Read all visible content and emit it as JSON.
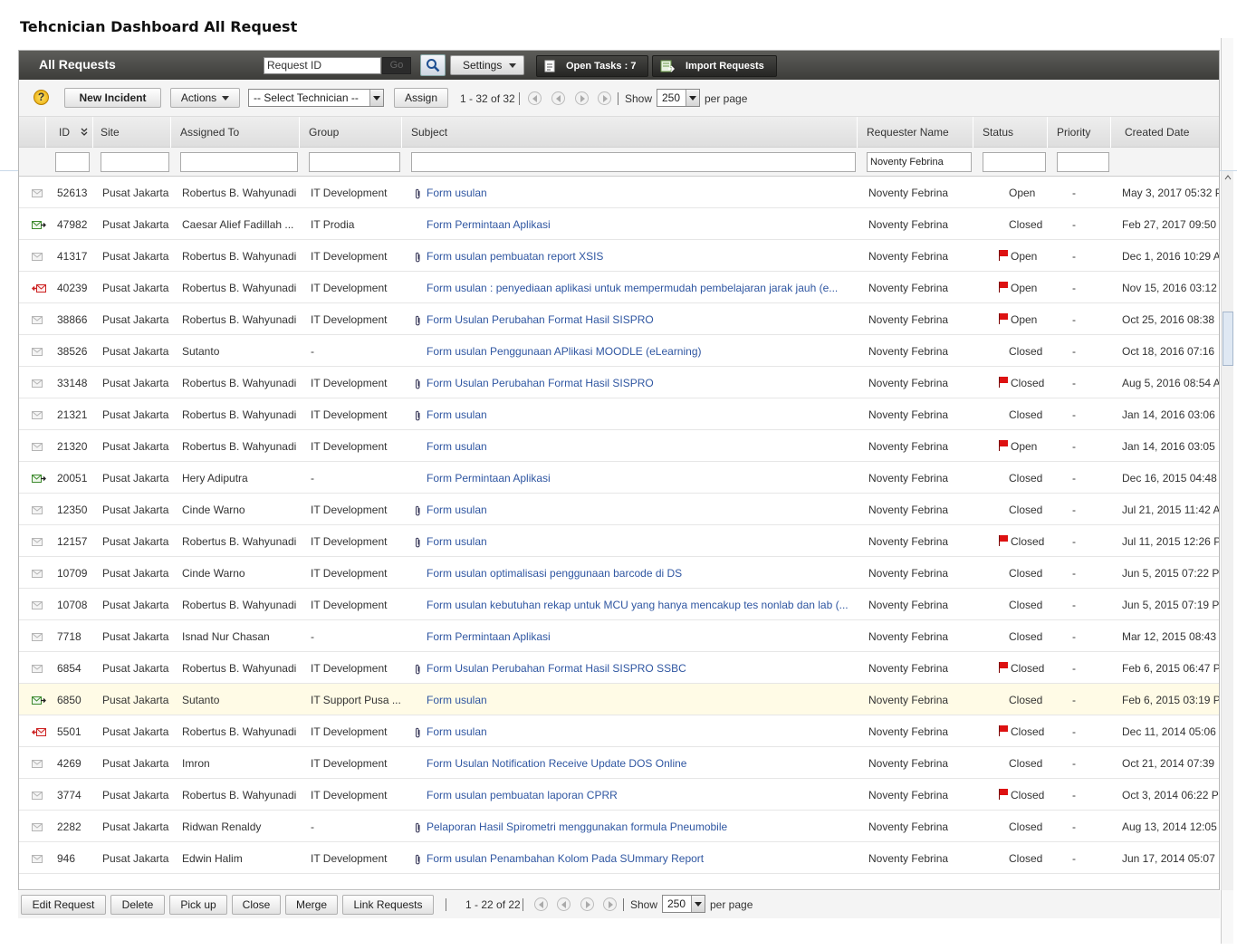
{
  "page_title": "Tehcnician Dashboard All Request",
  "header": {
    "title": "All Requests",
    "request_id_value": "Request ID",
    "go_label": "Go",
    "settings_label": "Settings",
    "open_tasks_label": "Open Tasks : 7",
    "import_label": "Import Requests"
  },
  "toolbar": {
    "help": "?",
    "new_incident": "New Incident",
    "actions": "Actions",
    "technician_select": "-- Select Technician --",
    "assign": "Assign",
    "range": "1 - 32 of 32",
    "show": "Show",
    "per_page_value": "250",
    "per_page": "per page"
  },
  "columns": {
    "id": "ID",
    "site": "Site",
    "assigned_to": "Assigned To",
    "group": "Group",
    "subject": "Subject",
    "requester": "Requester Name",
    "status": "Status",
    "priority": "Priority",
    "created": "Created Date"
  },
  "filters": {
    "requester_value": "Noventy Febrina"
  },
  "rows": [
    {
      "mail": "read",
      "id": "52613",
      "site": "Pusat Jakarta",
      "assigned": "Robertus B. Wahyunadi",
      "group": "IT Development",
      "clip": true,
      "subject": "Form usulan",
      "requester": "Noventy Febrina",
      "flag": false,
      "status": "Open",
      "priority": "-",
      "created": "May 3, 2017 05:32 P"
    },
    {
      "mail": "forward",
      "id": "47982",
      "site": "Pusat Jakarta",
      "assigned": "Caesar Alief Fadillah ...",
      "group": "IT Prodia",
      "clip": false,
      "subject": "Form Permintaan Aplikasi",
      "requester": "Noventy Febrina",
      "flag": false,
      "status": "Closed",
      "priority": "-",
      "created": "Feb 27, 2017 09:50"
    },
    {
      "mail": "read",
      "id": "41317",
      "site": "Pusat Jakarta",
      "assigned": "Robertus B. Wahyunadi",
      "group": "IT Development",
      "clip": true,
      "subject": "Form usulan pembuatan report XSIS",
      "requester": "Noventy Febrina",
      "flag": true,
      "status": "Open",
      "priority": "-",
      "created": "Dec 1, 2016 10:29 A"
    },
    {
      "mail": "reply",
      "id": "40239",
      "site": "Pusat Jakarta",
      "assigned": "Robertus B. Wahyunadi",
      "group": "IT Development",
      "clip": false,
      "subject": "Form usulan : penyediaan aplikasi untuk mempermudah pembelajaran jarak jauh (e...",
      "requester": "Noventy Febrina",
      "flag": true,
      "status": "Open",
      "priority": "-",
      "created": "Nov 15, 2016 03:12"
    },
    {
      "mail": "read",
      "id": "38866",
      "site": "Pusat Jakarta",
      "assigned": "Robertus B. Wahyunadi",
      "group": "IT Development",
      "clip": true,
      "subject": "Form Usulan Perubahan Format Hasil SISPRO",
      "requester": "Noventy Febrina",
      "flag": true,
      "status": "Open",
      "priority": "-",
      "created": "Oct 25, 2016 08:38"
    },
    {
      "mail": "read",
      "id": "38526",
      "site": "Pusat Jakarta",
      "assigned": "Sutanto",
      "group": "-",
      "clip": false,
      "subject": "Form usulan Penggunaan APlikasi MOODLE (eLearning)",
      "requester": "Noventy Febrina",
      "flag": false,
      "status": "Closed",
      "priority": "-",
      "created": "Oct 18, 2016 07:16"
    },
    {
      "mail": "read",
      "id": "33148",
      "site": "Pusat Jakarta",
      "assigned": "Robertus B. Wahyunadi",
      "group": "IT Development",
      "clip": true,
      "subject": "Form Usulan Perubahan Format Hasil SISPRO",
      "requester": "Noventy Febrina",
      "flag": true,
      "status": "Closed",
      "priority": "-",
      "created": "Aug 5, 2016 08:54 A"
    },
    {
      "mail": "read",
      "id": "21321",
      "site": "Pusat Jakarta",
      "assigned": "Robertus B. Wahyunadi",
      "group": "IT Development",
      "clip": true,
      "subject": "Form usulan",
      "requester": "Noventy Febrina",
      "flag": false,
      "status": "Closed",
      "priority": "-",
      "created": "Jan 14, 2016 03:06"
    },
    {
      "mail": "read",
      "id": "21320",
      "site": "Pusat Jakarta",
      "assigned": "Robertus B. Wahyunadi",
      "group": "IT Development",
      "clip": false,
      "subject": "Form usulan",
      "requester": "Noventy Febrina",
      "flag": true,
      "status": "Open",
      "priority": "-",
      "created": "Jan 14, 2016 03:05"
    },
    {
      "mail": "forward",
      "id": "20051",
      "site": "Pusat Jakarta",
      "assigned": "Hery Adiputra",
      "group": "-",
      "clip": false,
      "subject": "Form Permintaan Aplikasi",
      "requester": "Noventy Febrina",
      "flag": false,
      "status": "Closed",
      "priority": "-",
      "created": "Dec 16, 2015 04:48"
    },
    {
      "mail": "read",
      "id": "12350",
      "site": "Pusat Jakarta",
      "assigned": "Cinde Warno",
      "group": "IT Development",
      "clip": true,
      "subject": "Form usulan",
      "requester": "Noventy Febrina",
      "flag": false,
      "status": "Closed",
      "priority": "-",
      "created": "Jul 21, 2015 11:42 A"
    },
    {
      "mail": "read",
      "id": "12157",
      "site": "Pusat Jakarta",
      "assigned": "Robertus B. Wahyunadi",
      "group": "IT Development",
      "clip": true,
      "subject": "Form usulan",
      "requester": "Noventy Febrina",
      "flag": true,
      "status": "Closed",
      "priority": "-",
      "created": "Jul 11, 2015 12:26 P"
    },
    {
      "mail": "read",
      "id": "10709",
      "site": "Pusat Jakarta",
      "assigned": "Cinde Warno",
      "group": "IT Development",
      "clip": false,
      "subject": "Form usulan optimalisasi penggunaan barcode di DS",
      "requester": "Noventy Febrina",
      "flag": false,
      "status": "Closed",
      "priority": "-",
      "created": "Jun 5, 2015 07:22 P"
    },
    {
      "mail": "read",
      "id": "10708",
      "site": "Pusat Jakarta",
      "assigned": "Robertus B. Wahyunadi",
      "group": "IT Development",
      "clip": false,
      "subject": "Form usulan kebutuhan rekap untuk MCU yang hanya mencakup tes nonlab dan lab (...",
      "requester": "Noventy Febrina",
      "flag": false,
      "status": "Closed",
      "priority": "-",
      "created": "Jun 5, 2015 07:19 P"
    },
    {
      "mail": "read",
      "id": "7718",
      "site": "Pusat Jakarta",
      "assigned": "Isnad Nur Chasan",
      "group": "-",
      "clip": false,
      "subject": "Form Permintaan Aplikasi",
      "requester": "Noventy Febrina",
      "flag": false,
      "status": "Closed",
      "priority": "-",
      "created": "Mar 12, 2015 08:43"
    },
    {
      "mail": "read",
      "id": "6854",
      "site": "Pusat Jakarta",
      "assigned": "Robertus B. Wahyunadi",
      "group": "IT Development",
      "clip": true,
      "subject": "Form Usulan Perubahan Format Hasil SISPRO SSBC",
      "requester": "Noventy Febrina",
      "flag": true,
      "status": "Closed",
      "priority": "-",
      "created": "Feb 6, 2015 06:47 P"
    },
    {
      "mail": "forward",
      "id": "6850",
      "site": "Pusat Jakarta",
      "assigned": "Sutanto",
      "group": "IT Support Pusa ...",
      "clip": false,
      "subject": "Form usulan",
      "requester": "Noventy Febrina",
      "flag": false,
      "status": "Closed",
      "priority": "-",
      "created": "Feb 6, 2015 03:19 P",
      "highlight": true
    },
    {
      "mail": "reply",
      "id": "5501",
      "site": "Pusat Jakarta",
      "assigned": "Robertus B. Wahyunadi",
      "group": "IT Development",
      "clip": true,
      "subject": "Form usulan",
      "requester": "Noventy Febrina",
      "flag": true,
      "status": "Closed",
      "priority": "-",
      "created": "Dec 11, 2014 05:06"
    },
    {
      "mail": "read",
      "id": "4269",
      "site": "Pusat Jakarta",
      "assigned": "Imron",
      "group": "IT Development",
      "clip": false,
      "subject": "Form Usulan Notification Receive Update DOS Online",
      "requester": "Noventy Febrina",
      "flag": false,
      "status": "Closed",
      "priority": "-",
      "created": "Oct 21, 2014 07:39"
    },
    {
      "mail": "read",
      "id": "3774",
      "site": "Pusat Jakarta",
      "assigned": "Robertus B. Wahyunadi",
      "group": "IT Development",
      "clip": false,
      "subject": "Form usulan pembuatan laporan CPRR",
      "requester": "Noventy Febrina",
      "flag": true,
      "status": "Closed",
      "priority": "-",
      "created": "Oct 3, 2014 06:22 P"
    },
    {
      "mail": "read",
      "id": "2282",
      "site": "Pusat Jakarta",
      "assigned": "Ridwan Renaldy",
      "group": "-",
      "clip": true,
      "subject": "Pelaporan Hasil Spirometri menggunakan formula Pneumobile",
      "requester": "Noventy Febrina",
      "flag": false,
      "status": "Closed",
      "priority": "-",
      "created": "Aug 13, 2014 12:05"
    },
    {
      "mail": "read",
      "id": "946",
      "site": "Pusat Jakarta",
      "assigned": "Edwin Halim",
      "group": "IT Development",
      "clip": true,
      "subject": "Form usulan Penambahan Kolom Pada SUmmary Report",
      "requester": "Noventy Febrina",
      "flag": false,
      "status": "Closed",
      "priority": "-",
      "created": "Jun 17, 2014 05:07"
    }
  ],
  "footer": {
    "edit": "Edit Request",
    "delete": "Delete",
    "pickup": "Pick up",
    "close": "Close",
    "merge": "Merge",
    "link": "Link Requests",
    "range": "1 - 22 of 22",
    "show": "Show",
    "per_page_value": "250",
    "per_page": "per page"
  },
  "colors": {
    "link": "#2f56a1",
    "flag": "#dd1111",
    "header_bar": "#4a4a47",
    "highlight_row": "#fffbe6"
  }
}
